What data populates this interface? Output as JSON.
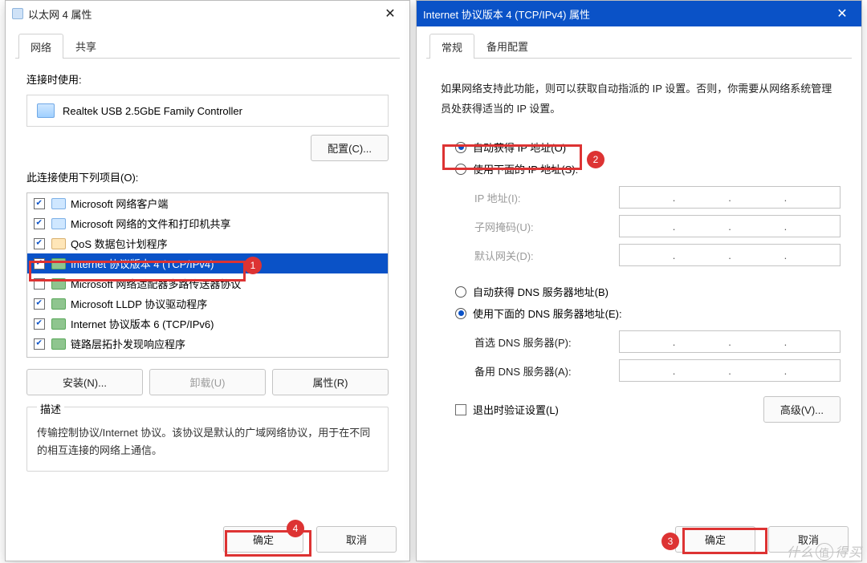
{
  "win1": {
    "title": "以太网 4 属性",
    "tabs": {
      "network": "网络",
      "share": "共享"
    },
    "connect_label": "连接时使用:",
    "adapter": "Realtek USB 2.5GbE Family Controller",
    "configure_btn": "配置(C)...",
    "list_label": "此连接使用下列项目(O):",
    "components": [
      {
        "label": "Microsoft 网络客户端",
        "checked": true,
        "icon": "net"
      },
      {
        "label": "Microsoft 网络的文件和打印机共享",
        "checked": true,
        "icon": "net"
      },
      {
        "label": "QoS 数据包计划程序",
        "checked": true,
        "icon": "qos"
      },
      {
        "label": "Internet 协议版本 4 (TCP/IPv4)",
        "checked": true,
        "icon": "proto",
        "selected": true
      },
      {
        "label": "Microsoft 网络适配器多路传送器协议",
        "checked": false,
        "icon": "proto"
      },
      {
        "label": "Microsoft LLDP 协议驱动程序",
        "checked": true,
        "icon": "proto"
      },
      {
        "label": "Internet 协议版本 6 (TCP/IPv6)",
        "checked": true,
        "icon": "proto"
      },
      {
        "label": "链路层拓扑发现响应程序",
        "checked": true,
        "icon": "proto"
      }
    ],
    "install_btn": "安装(N)...",
    "uninstall_btn": "卸载(U)",
    "props_btn": "属性(R)",
    "desc_title": "描述",
    "desc_text": "传输控制协议/Internet 协议。该协议是默认的广域网络协议，用于在不同的相互连接的网络上通信。",
    "ok": "确定",
    "cancel": "取消"
  },
  "win2": {
    "title": "Internet 协议版本 4 (TCP/IPv4) 属性",
    "tabs": {
      "general": "常规",
      "alt": "备用配置"
    },
    "info": "如果网络支持此功能，则可以获取自动指派的 IP 设置。否则，你需要从网络系统管理员处获得适当的 IP 设置。",
    "ip_auto": "自动获得 IP 地址(O)",
    "ip_manual": "使用下面的 IP 地址(S):",
    "ip_label": "IP 地址(I):",
    "mask_label": "子网掩码(U):",
    "gw_label": "默认网关(D):",
    "dns_auto": "自动获得 DNS 服务器地址(B)",
    "dns_manual": "使用下面的 DNS 服务器地址(E):",
    "dns1_label": "首选 DNS 服务器(P):",
    "dns2_label": "备用 DNS 服务器(A):",
    "validate_chk": "退出时验证设置(L)",
    "advanced_btn": "高级(V)...",
    "ok": "确定",
    "cancel": "取消"
  },
  "annotations": {
    "n1": "1",
    "n2": "2",
    "n3": "3",
    "n4": "4"
  },
  "watermark": {
    "pre": "什么",
    "c": "值",
    "post": "得买"
  }
}
